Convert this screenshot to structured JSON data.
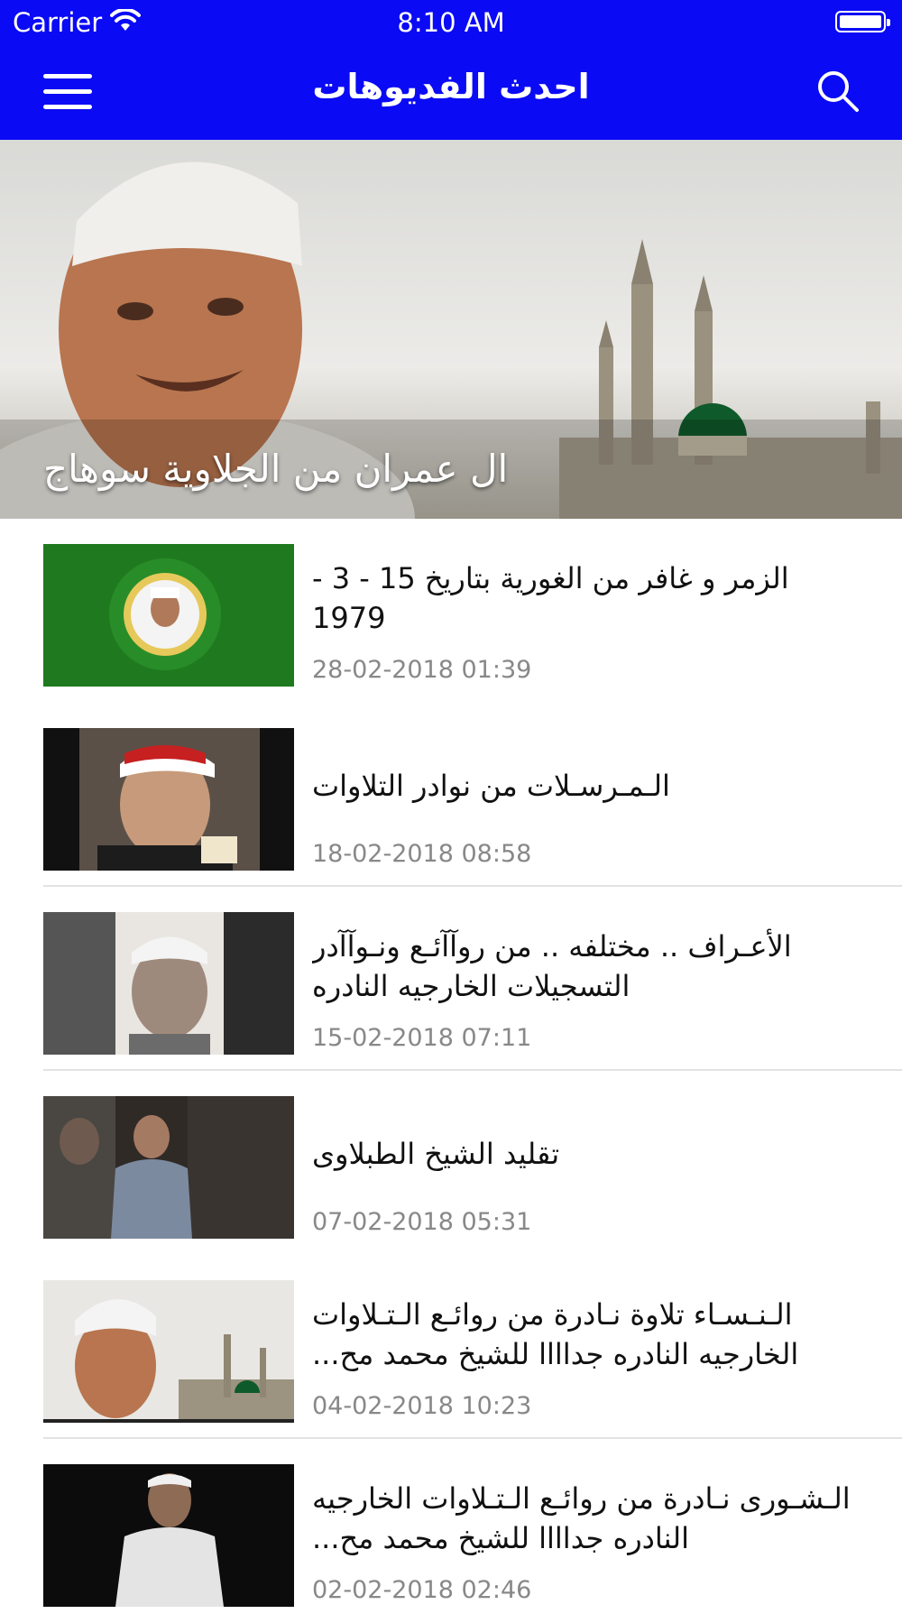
{
  "status_bar": {
    "carrier": "Carrier",
    "time": "8:10 AM"
  },
  "nav": {
    "title": "احدث الفديوهات",
    "menu_icon": "hamburger-menu-icon",
    "search_icon": "search-icon"
  },
  "featured": {
    "title": "ال عمران من الجلاوية سوهاج"
  },
  "videos": [
    {
      "title": "الزمر و غافر  من  الغورية بتاريخ  15 - 3 - 1979",
      "date": "28-02-2018 01:39"
    },
    {
      "title": "الـمـرسـلات من نوادر التلاوات",
      "date": "18-02-2018 08:58"
    },
    {
      "title": "الأعـراف .. مختلفه ..  من روآآئـع ونـوآآدر التسجيلات الخارجيه النادره",
      "date": "15-02-2018 07:11"
    },
    {
      "title": "تقليد الشيخ الطبلاوى",
      "date": "07-02-2018 05:31"
    },
    {
      "title": "الـنـسـاء تلاوة نـادرة من روائـع الـتـلاوات الخارجيه النادره جداااا للشيخ محمد مح...",
      "date": "04-02-2018 10:23"
    },
    {
      "title": "الـشـورى نـادرة من روائـع الـتـلاوات الخارجيه النادره جداااا للشيخ محمد مح...",
      "date": "02-02-2018 02:46"
    }
  ],
  "colors": {
    "accent": "#0a0af5",
    "date_text": "#888888"
  }
}
